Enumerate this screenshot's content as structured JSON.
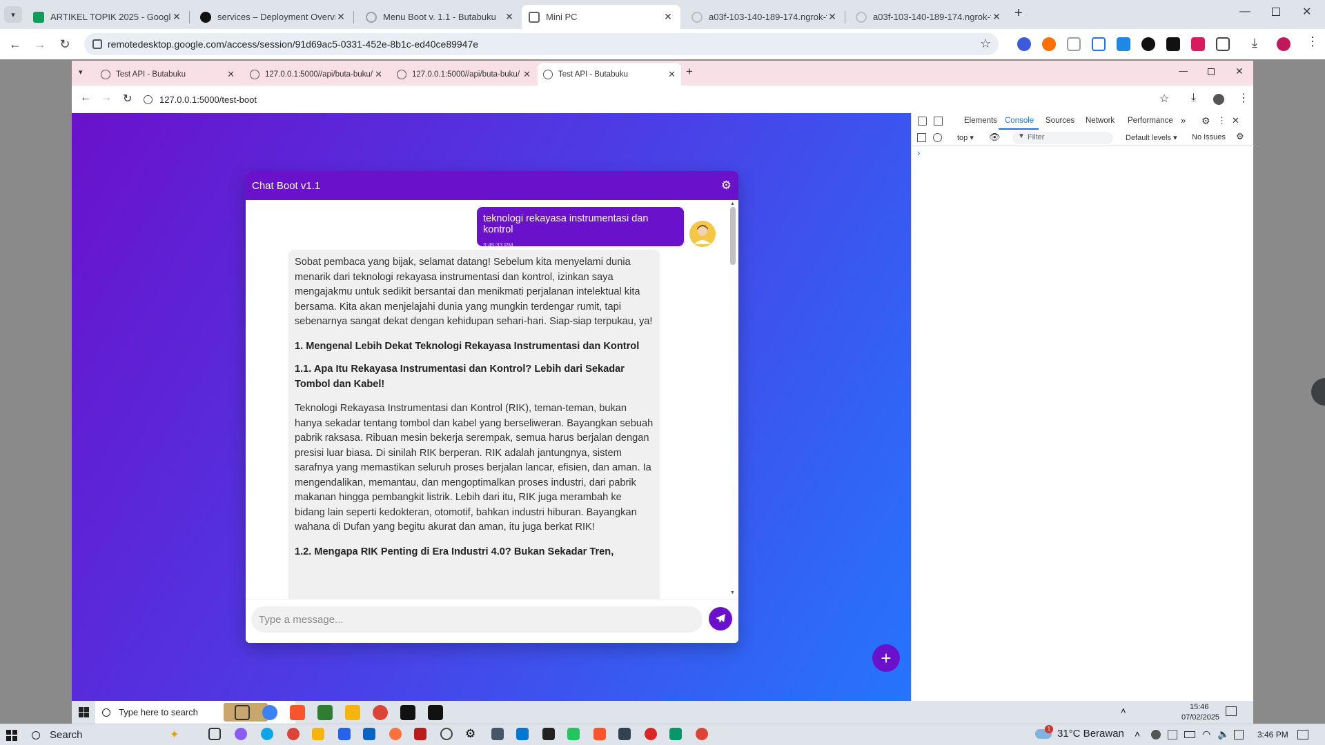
{
  "outer_tabs": [
    {
      "title": "ARTIKEL TOPIK 2025 - Google S",
      "icon_color": "#0f9d58"
    },
    {
      "title": "services – Deployment Overvie",
      "icon_color": "#000000"
    },
    {
      "title": "Menu Boot v. 1.1 - Butabuku",
      "icon_color": "#bdbdbd"
    },
    {
      "title": "Mini PC",
      "icon_color": "#5f6368"
    },
    {
      "title": "a03f-103-140-189-174.ngrok-fr",
      "icon_color": "#bdbdbd"
    },
    {
      "title": "a03f-103-140-189-174.ngrok-fr",
      "icon_color": "#bdbdbd"
    }
  ],
  "outer_url": "remotedesktop.google.com/access/session/91d69ac5-0331-452e-8b1c-ed40ce89947e",
  "inner_tabs": [
    {
      "title": "Test API - Butabuku"
    },
    {
      "title": "127.0.0.1:5000//api/buta-buku/"
    },
    {
      "title": "127.0.0.1:5000//api/buta-buku/"
    },
    {
      "title": "Test API - Butabuku"
    }
  ],
  "inner_url": "127.0.0.1:5000/test-boot",
  "chat": {
    "title": "Chat Boot v1.1",
    "user_message": "teknologi rekayasa instrumentasi dan kontrol",
    "user_time": "3:45:33 PM",
    "input_placeholder": "Type a message...",
    "bot_intro": "Sobat pembaca yang bijak, selamat datang! Sebelum kita menyelami dunia menarik dari teknologi rekayasa instrumentasi dan kontrol, izinkan saya mengajakmu untuk sedikit bersantai dan menikmati perjalanan intelektual kita bersama. Kita akan menjelajahi dunia yang mungkin terdengar rumit, tapi sebenarnya sangat dekat dengan kehidupan sehari-hari. Siap-siap terpukau, ya!",
    "heading1": "1. Mengenal Lebih Dekat Teknologi Rekayasa Instrumentasi dan Kontrol",
    "heading1_1": "1.1. Apa Itu Rekayasa Instrumentasi dan Kontrol? Lebih dari Sekadar Tombol dan Kabel!",
    "para1": "Teknologi Rekayasa Instrumentasi dan Kontrol (RIK), teman-teman, bukan hanya sekadar tentang tombol dan kabel yang berseliweran. Bayangkan sebuah pabrik raksasa. Ribuan mesin bekerja serempak, semua harus berjalan dengan presisi luar biasa. Di sinilah RIK berperan. RIK adalah jantungnya, sistem sarafnya yang memastikan seluruh proses berjalan lancar, efisien, dan aman. Ia mengendalikan, memantau, dan mengoptimalkan proses industri, dari pabrik makanan hingga pembangkit listrik. Lebih dari itu, RIK juga merambah ke bidang lain seperti kedokteran, otomotif, bahkan industri hiburan. Bayangkan wahana di Dufan yang begitu akurat dan aman, itu juga berkat RIK!",
    "heading1_2": "1.2. Mengapa RIK Penting di Era Industri 4.0? Bukan Sekadar Tren,"
  },
  "devtools": {
    "tabs": [
      "Elements",
      "Console",
      "Sources",
      "Network",
      "Performance"
    ],
    "active_tab": "Console",
    "context": "top ▾",
    "filter_placeholder": "Filter",
    "levels": "Default levels ▾",
    "issues": "No Issues",
    "prompt": "›"
  },
  "inner_taskbar": {
    "search": "Type here to search",
    "time": "15:46",
    "date": "07/02/2025"
  },
  "outer_taskbar": {
    "search": "Search",
    "weather": "31°C Berawan",
    "weather_badge": "1",
    "time": "3:46 PM"
  },
  "colors": {
    "accent": "#6a11cb",
    "gradient_end": "#2575fc"
  }
}
